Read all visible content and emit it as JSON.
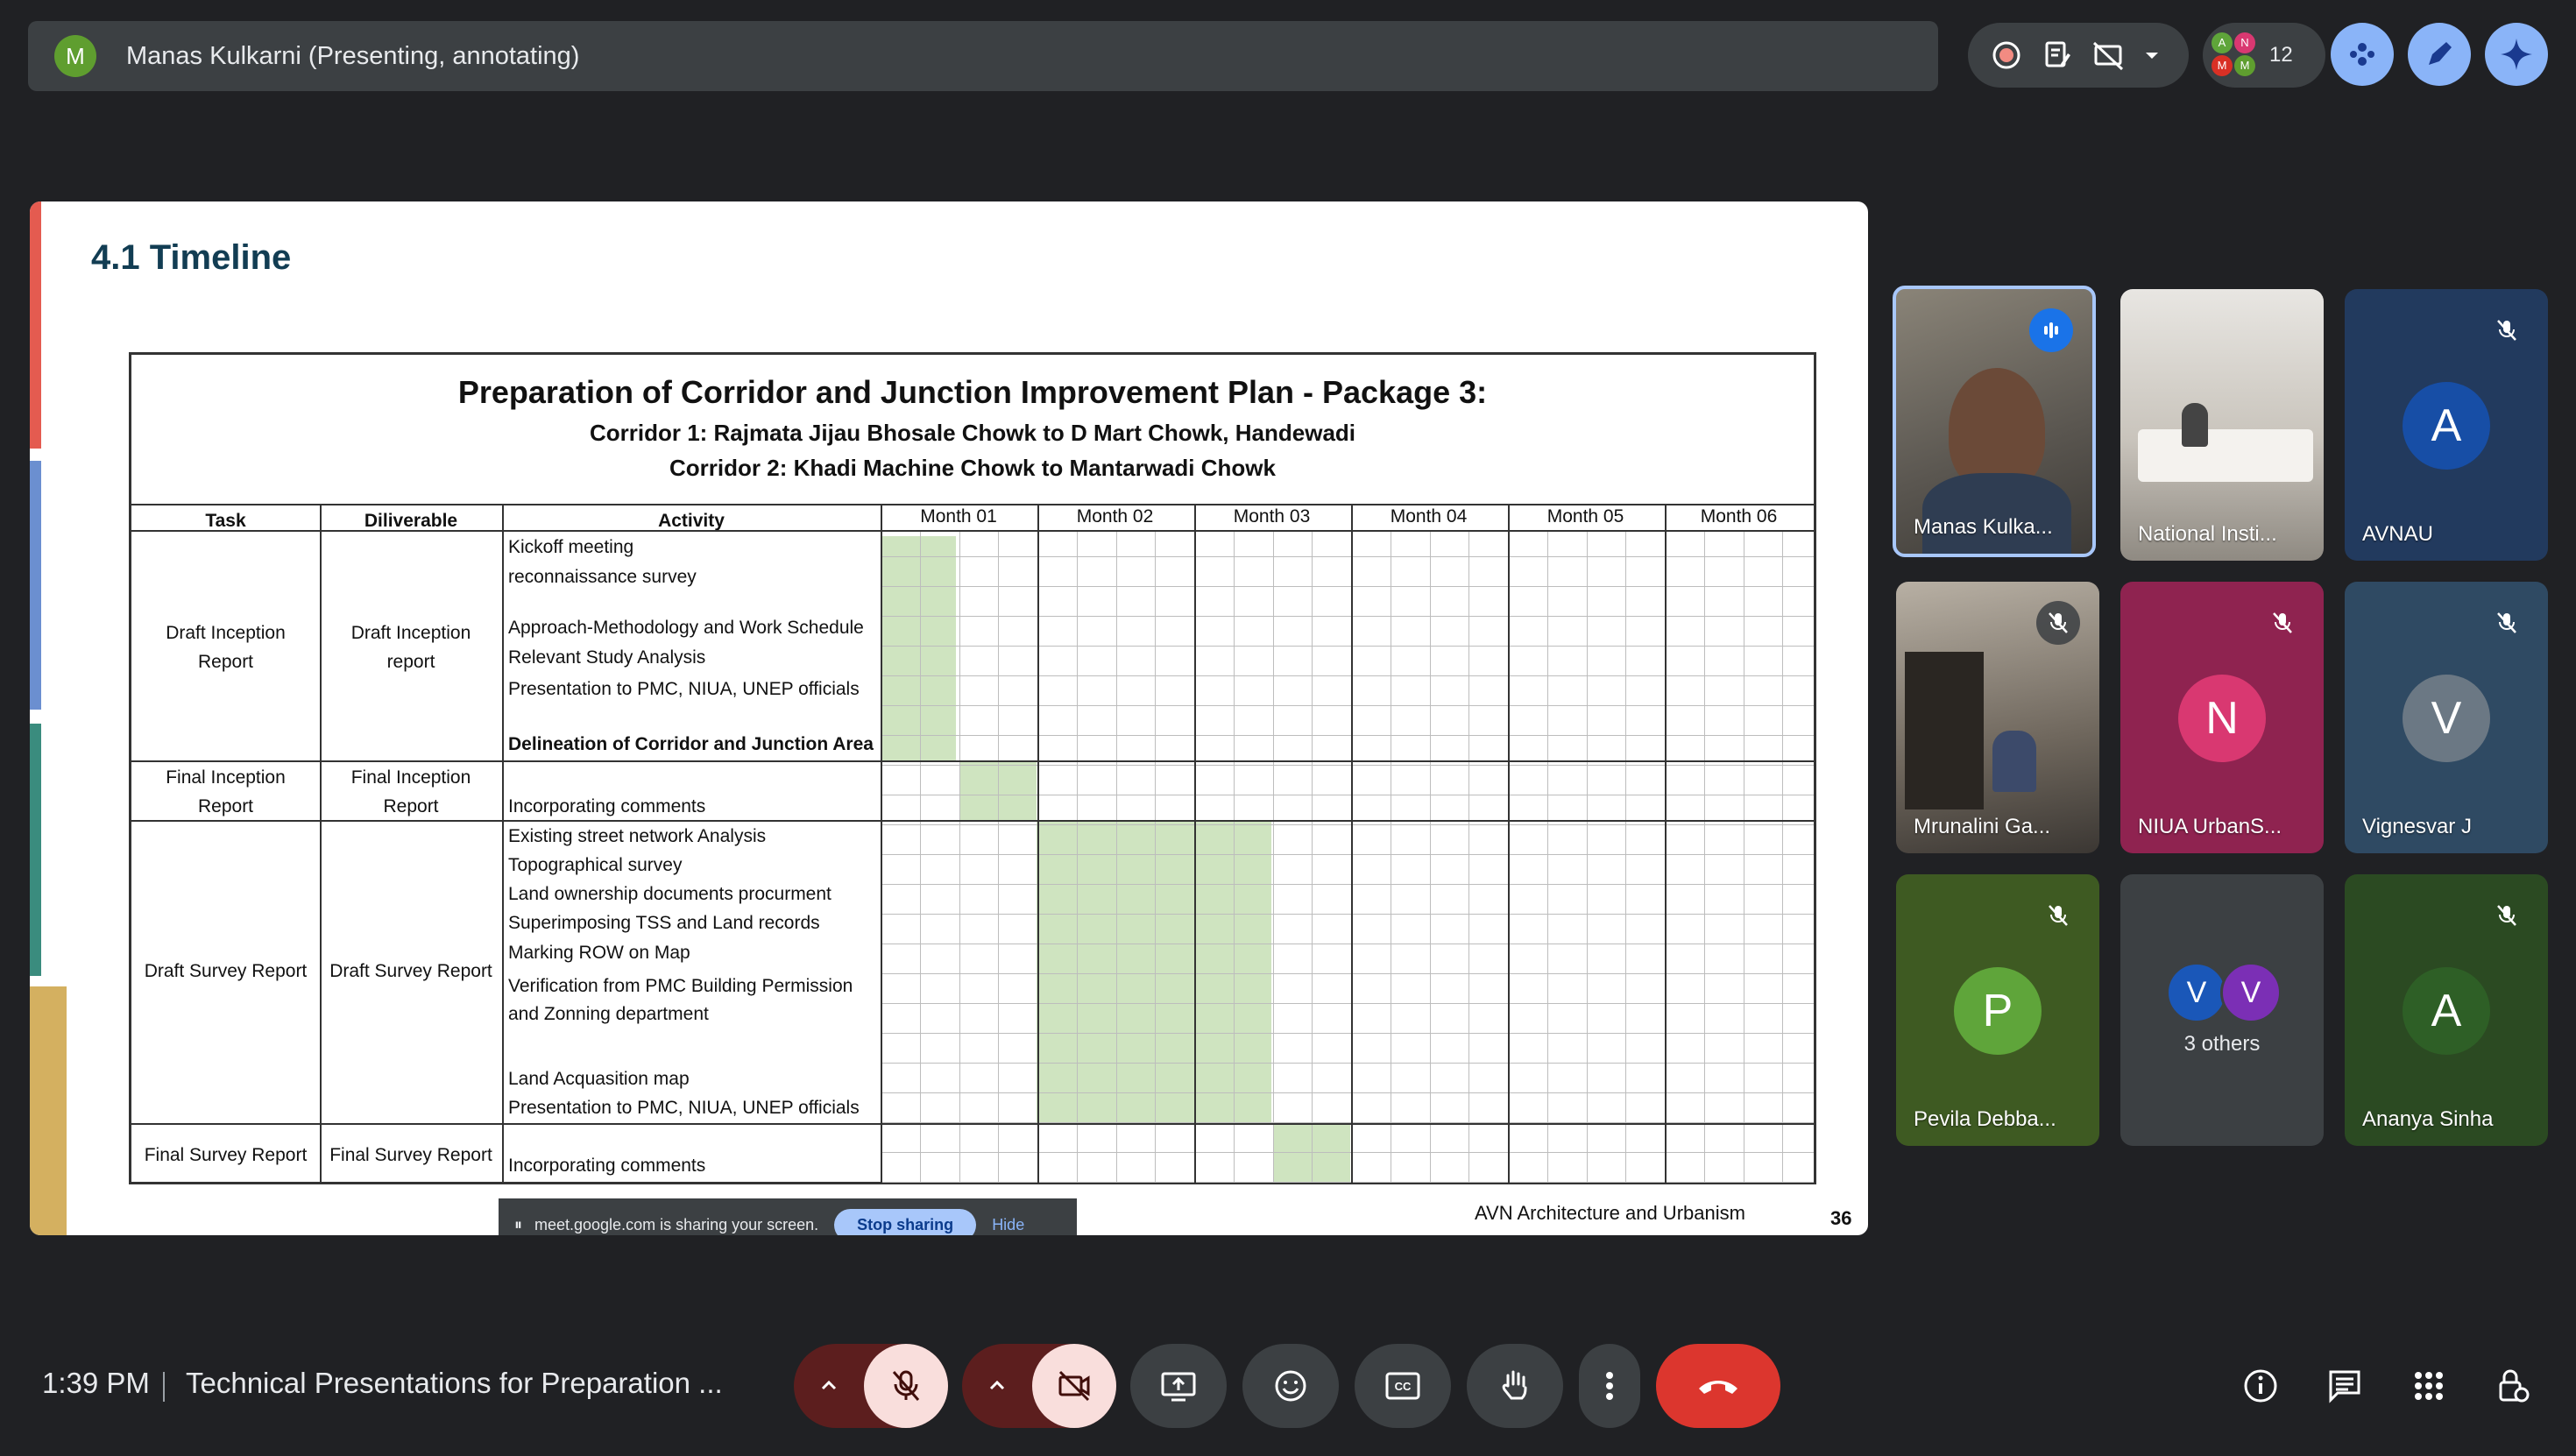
{
  "meeting": {
    "presenter_initial": "M",
    "presenter_banner": "Manas Kulkarni (Presenting, annotating)",
    "participant_count": "12",
    "time": "1:39 PM",
    "title": "Technical Presentations for Preparation ..."
  },
  "slide": {
    "heading": "4.1 Timeline",
    "table_title": "Preparation of Corridor and Junction Improvement Plan - Package 3:",
    "corridor_1": "Corridor 1: Rajmata Jijau Bhosale Chowk to D Mart Chowk, Handewadi",
    "corridor_2": "Corridor 2: Khadi Machine Chowk to Mantarwadi Chowk",
    "columns": {
      "task": "Task",
      "deliverable": "Diliverable",
      "activity": "Activity"
    },
    "months": [
      "Month 01",
      "Month 02",
      "Month 03",
      "Month 04",
      "Month 05",
      "Month 06"
    ],
    "groups": [
      {
        "task_line1": "Draft Inception",
        "task_line2": "Report",
        "deliv_line1": "Draft Inception",
        "deliv_line2": "report",
        "activities": [
          "Kickoff meeting",
          "reconnaissance survey",
          "Approach-Methodology and Work Schedule",
          "Relevant Study Analysis",
          "Presentation to PMC, NIUA, UNEP officials",
          "Delineation of Corridor and Junction Area"
        ]
      },
      {
        "task_line1": "Final Inception",
        "task_line2": "Report",
        "deliv_line1": "Final Inception",
        "deliv_line2": "Report",
        "activities": [
          "Incorporating comments"
        ]
      },
      {
        "task_line1": "Draft Survey Report",
        "deliv_line1": "Draft Survey Report",
        "activities": [
          "Existing street network Analysis",
          "Topographical survey",
          "Land ownership documents procurment",
          "Superimposing TSS and Land records",
          "Marking ROW on Map",
          "Verification from PMC Building Permission",
          "and Zonning department",
          "Land Acquasition map",
          "Presentation to PMC, NIUA, UNEP officials"
        ]
      },
      {
        "task_line1": "Final Survey Report",
        "deliv_line1": "Final Survey Report",
        "activities": [
          "Incorporating comments"
        ]
      }
    ],
    "footer_company": "AVN Architecture and Urbanism",
    "page_number": "36",
    "share_banner_text": "meet.google.com is sharing your screen.",
    "share_stop": "Stop sharing",
    "share_hide": "Hide"
  },
  "participants": [
    {
      "name": "Manas Kulka...",
      "type": "video",
      "speaking": true
    },
    {
      "name": "National Insti...",
      "type": "video"
    },
    {
      "name": "AVNAU",
      "initial": "A",
      "color": "#174ea6",
      "muted": true
    },
    {
      "name": "Mrunalini Ga...",
      "type": "video",
      "muted": true
    },
    {
      "name": "NIUA UrbanS...",
      "initial": "N",
      "color": "#d93871",
      "muted": true
    },
    {
      "name": "Vignesvar J",
      "initial": "V",
      "color": "#5f6368",
      "muted": true
    },
    {
      "name": "Pevila Debba...",
      "initial": "P",
      "color": "#5fa53a",
      "muted": true
    },
    {
      "name": "3 others",
      "initials": [
        "V",
        "V"
      ]
    },
    {
      "name": "Ananya Sinha",
      "initial": "A",
      "color": "#2e5f26",
      "muted": true
    }
  ],
  "colors": {
    "end_call": "#dc362e",
    "muted_red": "#f9dedc",
    "accent_blue": "#8ab4f8",
    "bar_bg": "#3c4043",
    "gantt_fill": "#cfe4c0"
  },
  "icons": [
    "record-icon",
    "notes-icon",
    "no-caption-icon",
    "dropdown-icon",
    "people-icon",
    "sparkle-icon",
    "mic-off-icon",
    "cam-off-icon",
    "present-icon",
    "emoji-icon",
    "captions-icon",
    "hand-icon",
    "more-icon",
    "end-call-icon",
    "info-icon",
    "chat-icon",
    "activities-icon",
    "host-controls-icon"
  ]
}
